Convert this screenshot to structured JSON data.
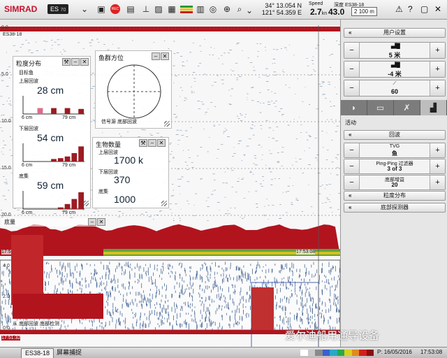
{
  "topbar": {
    "brand": "SIMRAD",
    "model": "ES",
    "model_num": "70",
    "rec": "REC",
    "lat": "34° 13.054",
    "lon": "121° 54.359",
    "lat_h": "N",
    "lon_h": "E",
    "speed_label": "Speed",
    "speed": "2.7",
    "speed_unit": "kn",
    "depth_label": "深度 ES38-18",
    "depth": "43.0",
    "range": "2",
    "range_unit": "100 m"
  },
  "echogram": {
    "channel": "ES38-18",
    "depth_ticks": [
      "0.0",
      "5.0",
      "10.0",
      "15.0",
      "20.0"
    ],
    "time_top": "17:53:08",
    "time_top_left": "17:5",
    "time_bottom": "17:51:32",
    "lower_ticks": [
      "4.0",
      "2.0",
      "0.0"
    ],
    "zoom_note": "从 底部回波 底部检测"
  },
  "size_panel": {
    "title": "粒度分布",
    "subtitle": "目标鱼",
    "sections": [
      {
        "label": "上层回波",
        "value": "28 cm"
      },
      {
        "label": "下层回波",
        "value": "54 cm"
      },
      {
        "label": "底集",
        "value": "59 cm"
      }
    ],
    "axis_min": "6 cm",
    "axis_max": "79 cm",
    "bars": [
      [
        0,
        0,
        0.35,
        0,
        0.35,
        0,
        0.35,
        0,
        0.3
      ],
      [
        0,
        0,
        0,
        0,
        0.15,
        0.2,
        0.3,
        0.5,
        0.9
      ],
      [
        0,
        0,
        0,
        0,
        0,
        0.1,
        0.3,
        0.6,
        1
      ]
    ]
  },
  "school_panel": {
    "title": "鱼群方位",
    "caption": "信号源 底部回波"
  },
  "biomass_panel": {
    "title": "生物数量",
    "sections": [
      {
        "label": "上层回波",
        "value": "1700 k"
      },
      {
        "label": "下层回波",
        "value": "370"
      },
      {
        "label": "底集",
        "value": "1000"
      }
    ]
  },
  "small_panel": {
    "title": "底量"
  },
  "side": {
    "menu": "用户设置",
    "steppers": [
      {
        "value": "5 米"
      },
      {
        "value": "-4 米"
      },
      {
        "value": "60"
      }
    ],
    "active": "活动",
    "items": [
      "回波",
      "TVG",
      "Ping-Ping 过滤器",
      "底部增益",
      "粒度分布",
      "底部探测器"
    ],
    "tvg_value": "鱼",
    "filter_value": "3 of 3",
    "gain_value": "20"
  },
  "bottom": {
    "tab1": "ES38-18",
    "tab2": "屏幕捕捉",
    "date": "P: 16/05/2016",
    "time": "17:53:08"
  },
  "watermark": "爱尔迪船用通导设备",
  "colors": {
    "echo_red": "#b2141e",
    "echo_green": "#5aa83c",
    "accent": "#c8102e"
  }
}
